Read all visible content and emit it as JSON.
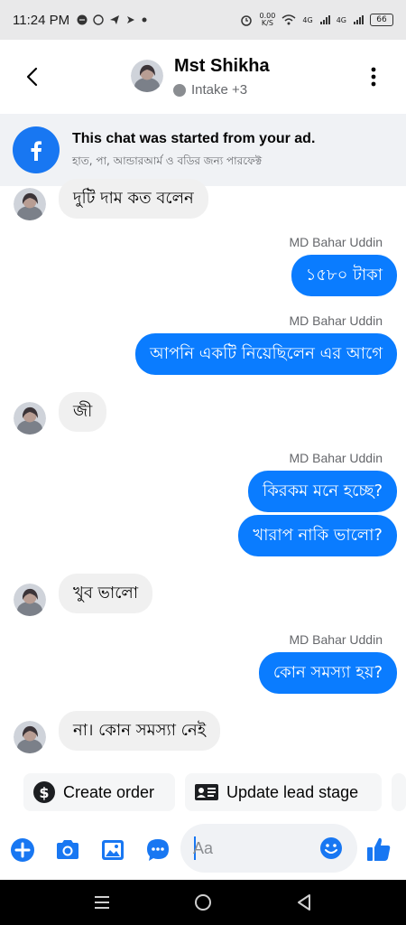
{
  "status_bar": {
    "time": "11:24 PM",
    "net_speed": "0.00\nK/S",
    "network_1": "4G",
    "network_2": "4G",
    "battery": "66"
  },
  "header": {
    "name": "Mst Shikha",
    "subtitle": "Intake +3"
  },
  "ad_banner": {
    "title": "This chat was started from your ad.",
    "subtitle": "হাত, পা, আন্ডারআর্ম ও বডির জন্য পারফেক্ট"
  },
  "messages": [
    {
      "direction": "in",
      "text": "দুটি দাম কত বলেন"
    },
    {
      "direction": "out",
      "sender": "MD Bahar Uddin",
      "text": "১৫৮০ টাকা"
    },
    {
      "direction": "out",
      "sender": "MD Bahar Uddin",
      "text": "আপনি একটি নিয়েছিলেন এর আগে"
    },
    {
      "direction": "in",
      "text": "জী"
    },
    {
      "direction": "out",
      "sender": "MD Bahar Uddin",
      "text": "কিরকম মনে হচ্ছে?"
    },
    {
      "direction": "out",
      "text": "খারাপ নাকি ভালো?"
    },
    {
      "direction": "in",
      "text": "খুব ভালো"
    },
    {
      "direction": "out",
      "sender": "MD Bahar Uddin",
      "text": "কোন সমস্যা হয়?"
    },
    {
      "direction": "in",
      "text": "না। কোন সমস্যা নেই"
    }
  ],
  "quick_actions": {
    "create_order": "Create order",
    "update_lead_stage": "Update lead stage"
  },
  "composer": {
    "placeholder": "Aa"
  },
  "colors": {
    "accent": "#1877f2",
    "outgoing_bubble": "#0a7cff",
    "incoming_bubble": "#f0f0f0"
  },
  "icons": [
    "back-arrow-icon",
    "more-vertical-icon",
    "facebook-icon",
    "dollar-icon",
    "id-card-icon",
    "plus-icon",
    "camera-icon",
    "image-icon",
    "messenger-icon",
    "emoji-icon",
    "thumbs-up-icon",
    "recents-icon",
    "home-icon",
    "back-nav-icon"
  ]
}
